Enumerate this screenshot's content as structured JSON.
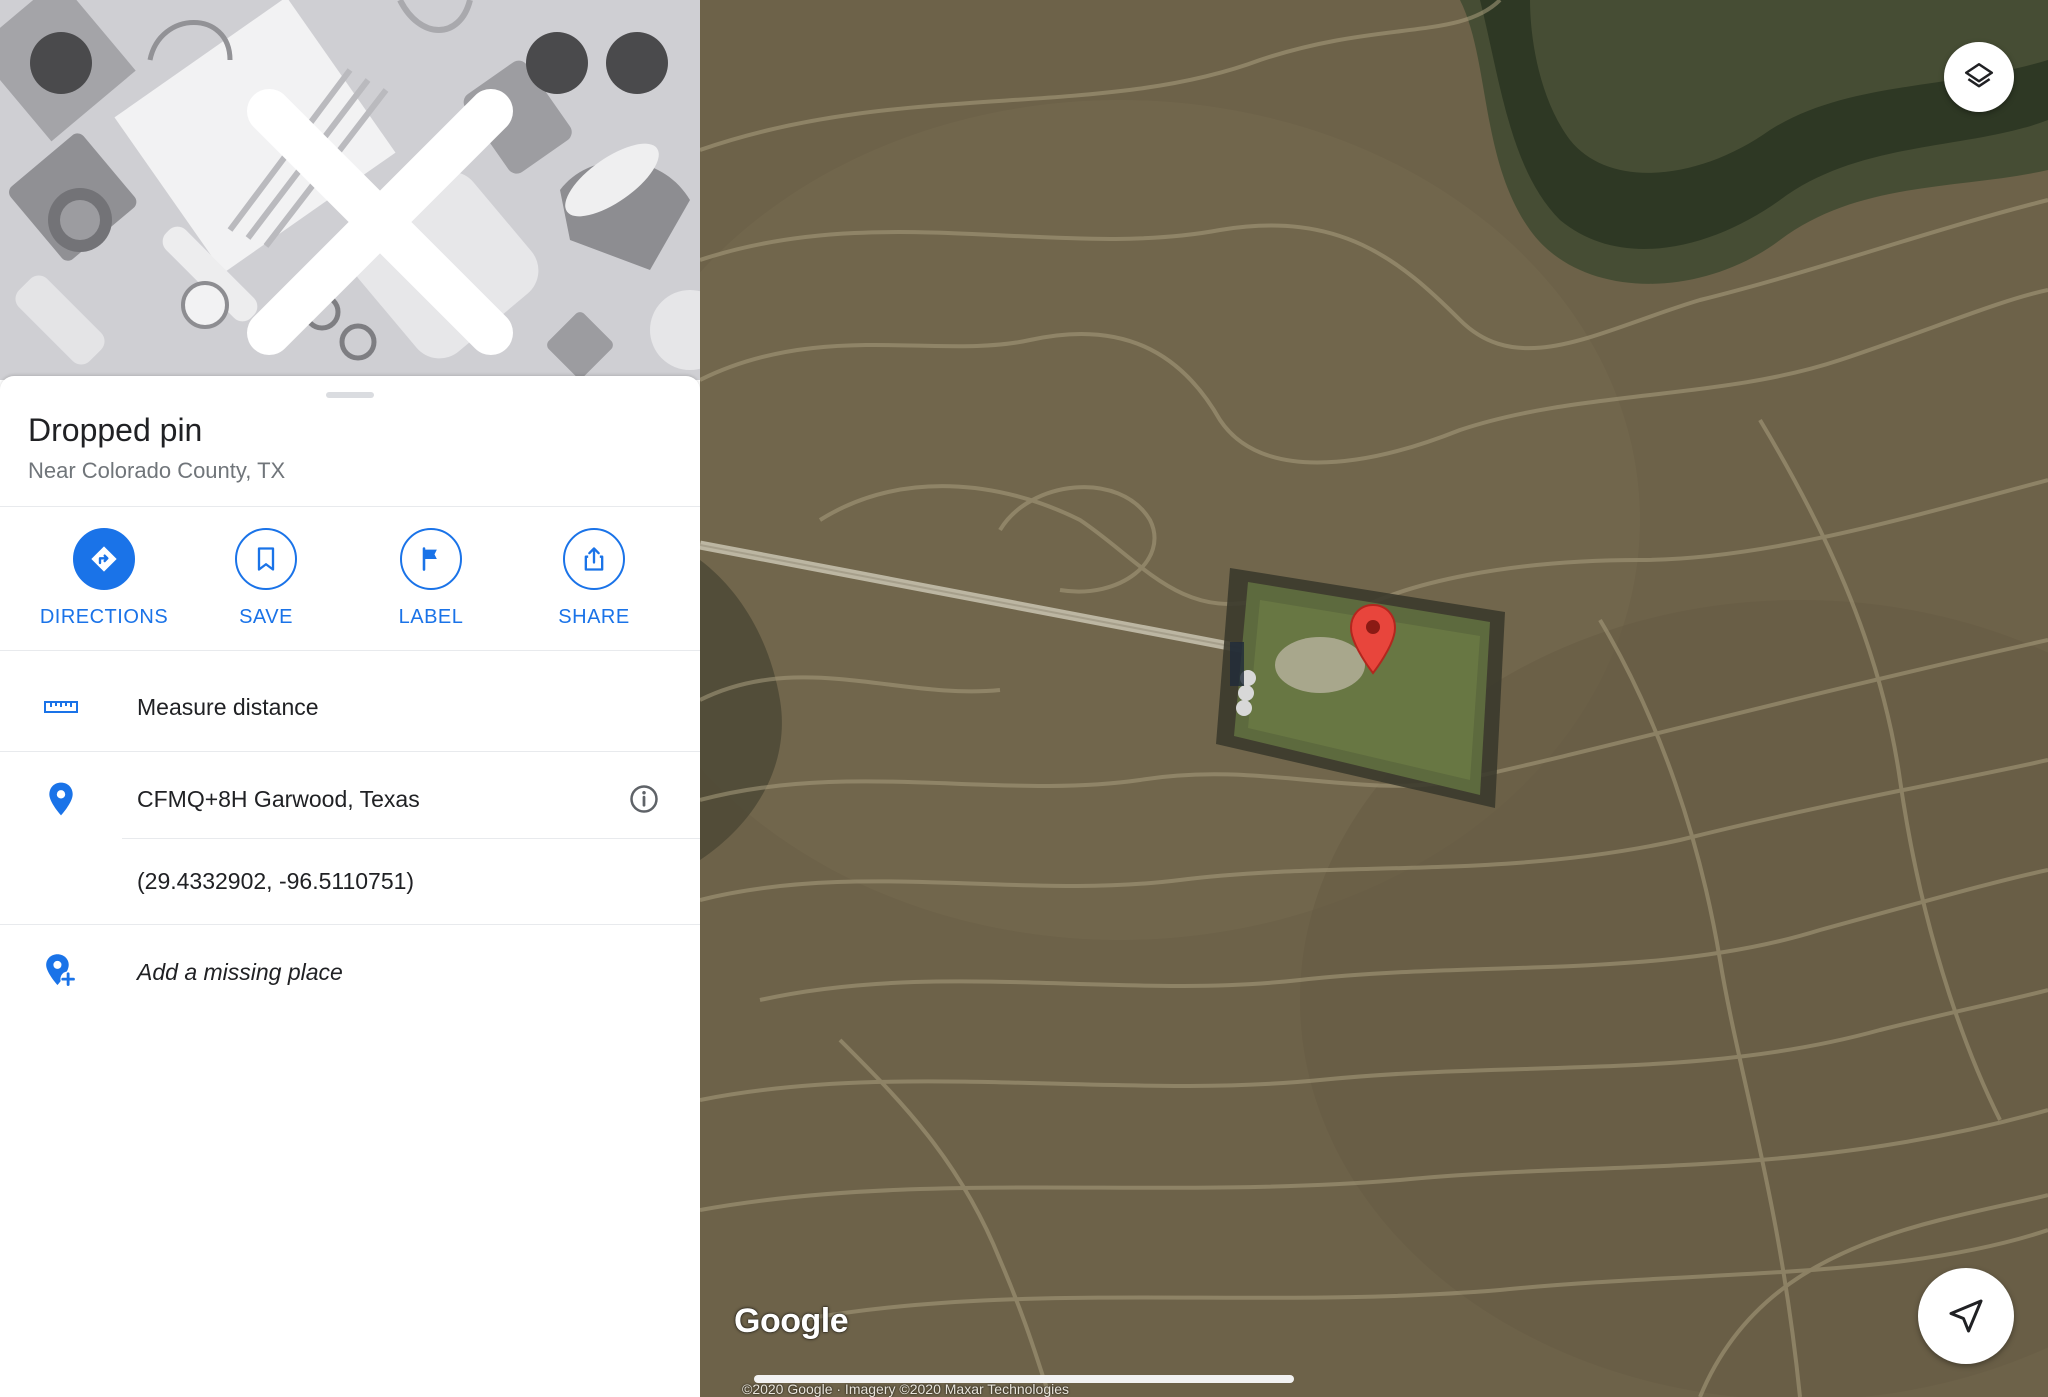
{
  "panel": {
    "hero_icons": [
      "close-icon",
      "share-icon",
      "more-icon"
    ],
    "title": "Dropped pin",
    "subtitle": "Near Colorado County, TX",
    "actions": [
      {
        "label": "DIRECTIONS",
        "icon": "directions-icon"
      },
      {
        "label": "SAVE",
        "icon": "bookmark-icon"
      },
      {
        "label": "LABEL",
        "icon": "flag-icon"
      },
      {
        "label": "SHARE",
        "icon": "share-icon"
      }
    ],
    "rows": {
      "measure": {
        "label": "Measure distance",
        "icon": "ruler-icon"
      },
      "plus_code": {
        "label": "CFMQ+8H Garwood, Texas",
        "icon": "location-pin-icon"
      },
      "coordinates": "(29.4332902, -96.5110751)",
      "add_place": {
        "label": "Add a missing place",
        "icon": "add-place-icon"
      }
    }
  },
  "map": {
    "logo": "Google",
    "attribution": "©2020 Google · Imagery ©2020 Maxar Technologies",
    "pin_color": "#e8453c",
    "accent": "#1a73e8"
  }
}
